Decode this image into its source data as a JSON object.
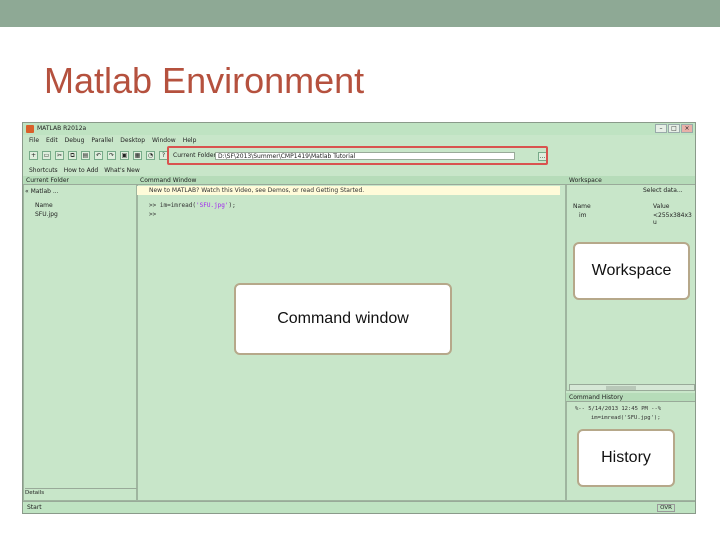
{
  "slide": {
    "title": "Matlab Environment"
  },
  "window": {
    "title": "MATLAB R2012a"
  },
  "menu": [
    "File",
    "Edit",
    "Debug",
    "Parallel",
    "Desktop",
    "Window",
    "Help"
  ],
  "current_folder": {
    "label": "Current Folder:",
    "path": "D:\\SF\\2013\\Summer\\CMP1419\\Matlab Tutorial"
  },
  "shortcuts": [
    "Shortcuts",
    "How to Add",
    "What's New"
  ],
  "folder_pane": {
    "title": "Current Folder",
    "nav": "« Matlab ...",
    "column": "Name",
    "files": [
      "SFU.jpg"
    ],
    "details": "Details"
  },
  "command_window": {
    "title": "Command Window",
    "notice": "New to MATLAB? Watch this Video, see Demos, or read Getting Started.",
    "lines": [
      {
        "prompt": ">>",
        "code": "im=imread(",
        "str": "'SFU.jpg'",
        "tail": ");"
      },
      {
        "prompt": ">>",
        "code": "",
        "str": "",
        "tail": ""
      }
    ]
  },
  "workspace": {
    "title": "Workspace",
    "select_data": "Select data...",
    "columns": [
      "Name",
      "Value"
    ],
    "rows": [
      {
        "name": "im",
        "value": "<255x384x3 u"
      }
    ]
  },
  "command_history": {
    "title": "Command History",
    "entries": [
      "%-- 5/14/2013 12:45 PM --%",
      "im=imread('SFU.jpg');"
    ]
  },
  "statusbar": {
    "start": "Start",
    "ovr": "OVR"
  },
  "callouts": {
    "workspace": "Workspace",
    "command_window": "Command window",
    "history": "History"
  }
}
